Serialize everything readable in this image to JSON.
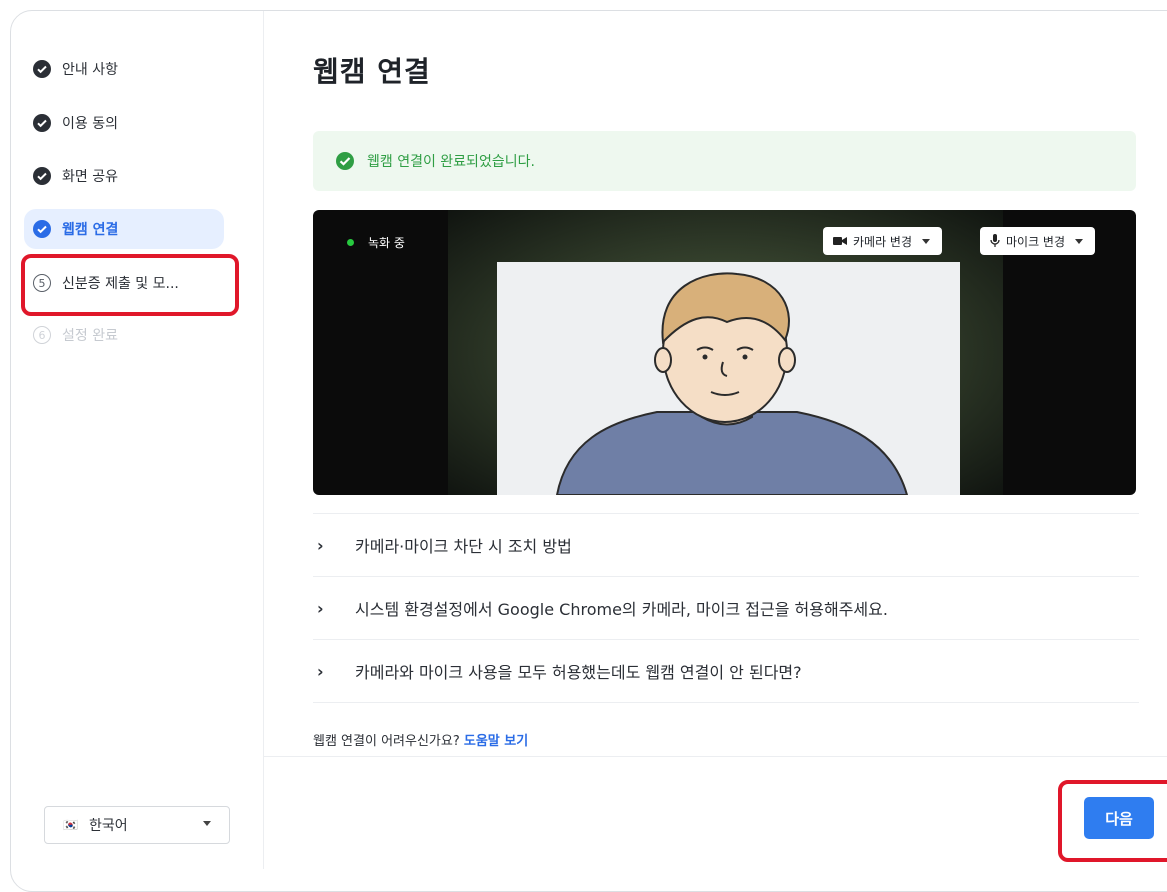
{
  "sidebar": {
    "steps": [
      {
        "label": "안내 사항",
        "state": "done"
      },
      {
        "label": "이용 동의",
        "state": "done"
      },
      {
        "label": "화면 공유",
        "state": "done"
      },
      {
        "label": "웹캠 연결",
        "state": "active"
      },
      {
        "label": "신분증 제출 및 모...",
        "number": "5",
        "state": "upcoming"
      },
      {
        "label": "설정 완료",
        "number": "6",
        "state": "disabled"
      }
    ],
    "language": {
      "flag": "🇰🇷",
      "label": "한국어"
    }
  },
  "main": {
    "title": "웹캠 연결",
    "banner": "웹캠 연결이 완료되었습니다.",
    "video": {
      "recording_label": "녹화 중",
      "camera_button": "카메라 변경",
      "mic_button": "마이크 변경"
    },
    "faq": [
      "카메라·마이크 차단 시 조치 방법",
      "시스템 환경설정에서 Google Chrome의 카메라, 마이크 접근을 허용해주세요.",
      "카메라와 마이크 사용을 모두 허용했는데도 웹캠 연결이 안 된다면?"
    ],
    "help_text": "웹캠 연결이 어려우신가요?",
    "help_link": "도움말 보기",
    "next_button": "다음"
  },
  "colors": {
    "accent": "#2f7df0",
    "success": "#2f9e44",
    "highlight": "#e0172a"
  }
}
